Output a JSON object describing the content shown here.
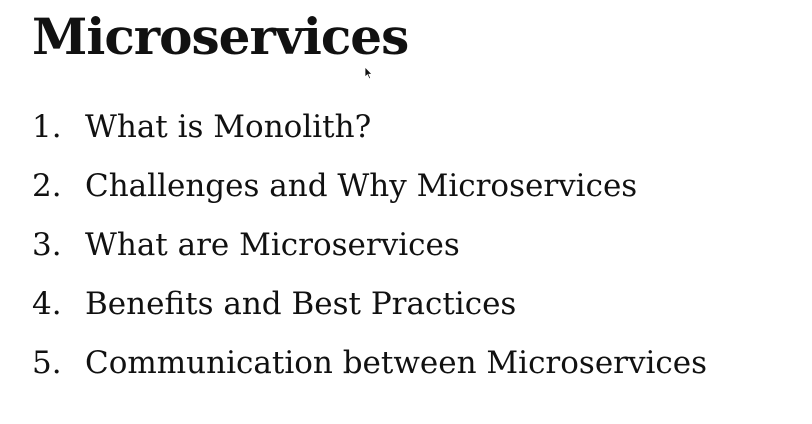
{
  "slide": {
    "title": "Microservices",
    "items": [
      {
        "number": "1.",
        "text": "What is Monolith?"
      },
      {
        "number": "2.",
        "text": "Challenges and Why Microservices"
      },
      {
        "number": "3.",
        "text": "What are Microservices"
      },
      {
        "number": "4.",
        "text": "Benefits and Best Practices"
      },
      {
        "number": "5.",
        "text": "Communication between Microservices"
      }
    ]
  },
  "icons": {
    "cursor": "mouse-pointer-icon"
  },
  "colors": {
    "background": "#ffffff",
    "text": "#111111"
  }
}
